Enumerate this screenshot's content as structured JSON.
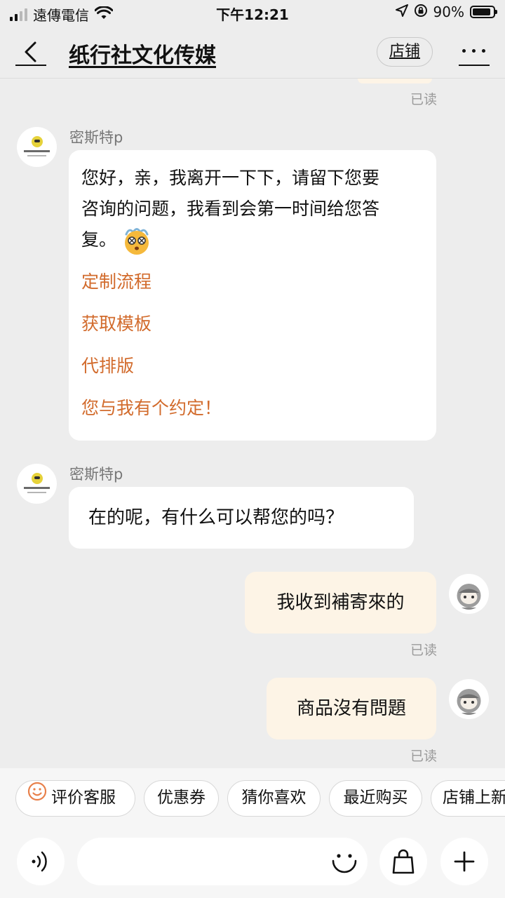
{
  "status_bar": {
    "carrier": "遠傳電信",
    "time": "下午12:21",
    "battery_percent": "90%",
    "battery_level": 0.9
  },
  "header": {
    "title": "纸行社文化传媒",
    "shop_label": "店铺"
  },
  "read_label": "已读",
  "messages": [
    {
      "side": "left",
      "sender": "密斯特p",
      "line1": "您好，亲，我离开一下下，请留下您要",
      "line2": "咨询的问题，我看到会第一时间给您答",
      "line3": "复。",
      "links": [
        "定制流程",
        "获取模板",
        "代排版",
        "您与我有个约定！"
      ]
    },
    {
      "side": "left",
      "sender": "密斯特p",
      "text": "在的呢，有什么可以帮您的吗？"
    },
    {
      "side": "right",
      "text": "我收到補寄來的"
    },
    {
      "side": "right",
      "text": "商品沒有問題"
    }
  ],
  "quick_replies": [
    "评价客服",
    "优惠券",
    "猜你喜欢",
    "最近购买",
    "店铺上新"
  ],
  "icons": {
    "signal": "signal-bars-icon",
    "wifi": "wifi-icon",
    "location": "location-arrow-icon",
    "rotation_lock": "rotation-lock-icon",
    "battery": "battery-icon",
    "back": "chevron-left-icon",
    "more": "more-dots-icon",
    "smile": "smile-icon",
    "voice": "voice-icon",
    "emoji": "emoji-icon",
    "bag": "shopping-bag-icon",
    "plus": "plus-icon"
  },
  "colors": {
    "accent_link": "#d26b2c",
    "user_bubble": "#fdf4e6",
    "chip_icon": "#e8804a",
    "background": "#ededed"
  }
}
